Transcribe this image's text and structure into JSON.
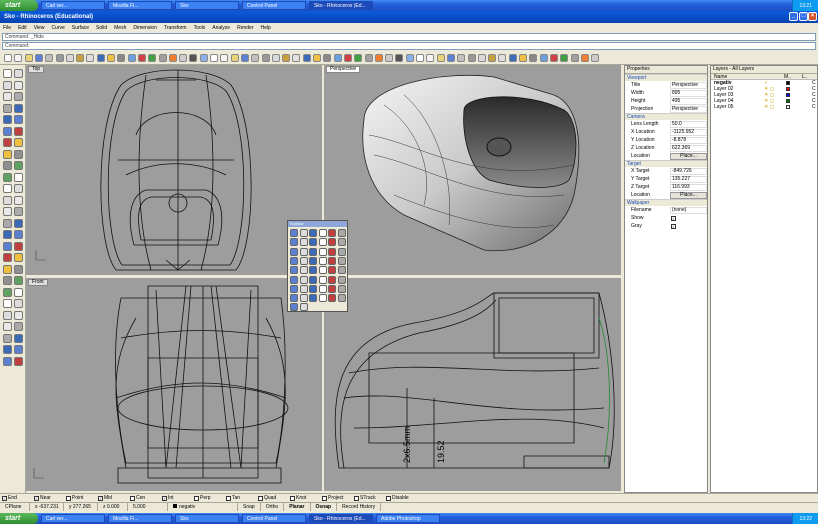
{
  "taskbar_top": {
    "start": "start",
    "tasks": [
      "Carl ver...",
      "Mozilla Fi...",
      "Sko",
      "Control Panel",
      "Sko - Rhinoceros (Ed..."
    ],
    "active_index": 4,
    "clock": "13:21"
  },
  "window": {
    "title": "Sko - Rhinoceros (Educational)"
  },
  "menu": [
    "File",
    "Edit",
    "View",
    "Curve",
    "Surface",
    "Solid",
    "Mesh",
    "Dimension",
    "Transform",
    "Tools",
    "Analyze",
    "Render",
    "Help"
  ],
  "command": {
    "history": "Command: _Hide",
    "prompt": "Command:"
  },
  "viewports": {
    "top": {
      "label": "Top"
    },
    "perspective": {
      "label": "Perspective"
    },
    "front": {
      "label": "Front"
    },
    "right": {
      "dim1": "2x6.5mm",
      "dim2": "19.52"
    }
  },
  "palette": {
    "title": "Surface"
  },
  "properties": {
    "tab": "Properties",
    "viewport": {
      "header": "Viewport",
      "rows": [
        {
          "k": "Title",
          "v": "Perspective"
        },
        {
          "k": "Width",
          "v": "895"
        },
        {
          "k": "Height",
          "v": "495"
        },
        {
          "k": "Projection",
          "v": "Perspective"
        }
      ]
    },
    "camera": {
      "header": "Camera",
      "rows": [
        {
          "k": "Lens Length",
          "v": "50.0"
        },
        {
          "k": "X Location",
          "v": "-1125.952"
        },
        {
          "k": "Y Location",
          "v": "-8.878"
        },
        {
          "k": "Z Location",
          "v": "622.369"
        }
      ],
      "location_label": "Location",
      "place_button": "Place..."
    },
    "target": {
      "header": "Target",
      "rows": [
        {
          "k": "X Target",
          "v": "-849.726"
        },
        {
          "k": "Y Target",
          "v": "135.227"
        },
        {
          "k": "Z Target",
          "v": "116.993"
        }
      ],
      "location_label": "Location",
      "place_button": "Place..."
    },
    "wallpaper": {
      "header": "Wallpaper",
      "filename_label": "Filename",
      "filename_value": "(none)",
      "show_label": "Show",
      "gray_label": "Gray"
    }
  },
  "layers": {
    "tab": "Layers - All Layers",
    "columns": [
      "Name",
      "M..",
      "L.."
    ],
    "rows": [
      {
        "name": "negativ",
        "color": "#000000",
        "current": true
      },
      {
        "name": "Layer 02",
        "color": "#ff0000"
      },
      {
        "name": "Layer 03",
        "color": "#0000ff"
      },
      {
        "name": "Layer 04",
        "color": "#008000"
      },
      {
        "name": "Layer 05",
        "color": "#ffffff"
      }
    ],
    "mat_suffix": "C"
  },
  "osnaps": [
    "End",
    "Near",
    "Point",
    "Mid",
    "Cen",
    "Int",
    "Perp",
    "Tan",
    "Quad",
    "Knot",
    "Project",
    "STrack",
    "Disable"
  ],
  "osnap_checked": [
    true,
    true,
    false,
    true,
    false,
    true,
    false,
    false,
    false,
    false,
    false,
    false,
    false
  ],
  "status": {
    "cplane": "CPlane",
    "x": "x -637.231",
    "y": "y 277.265",
    "z": "z 0.000",
    "val": "5.000",
    "layer": "negativ",
    "snap": "Snap",
    "ortho": "Ortho",
    "planar": "Planar",
    "osnap": "Osnap",
    "record": "Record History"
  },
  "taskbar_bottom": {
    "start": "start",
    "tasks": [
      "Carl ver...",
      "Mozilla Fi...",
      "Sko",
      "Control Panel",
      "Sko - Rhinoceros (Ed...",
      "Adobe Photoshop"
    ],
    "active_index": 4,
    "clock": "13:22"
  },
  "colors": {
    "viewport_bg": "#9d9d9d",
    "taskbar": "#245edb",
    "titlebar": "#0a5bdc"
  }
}
